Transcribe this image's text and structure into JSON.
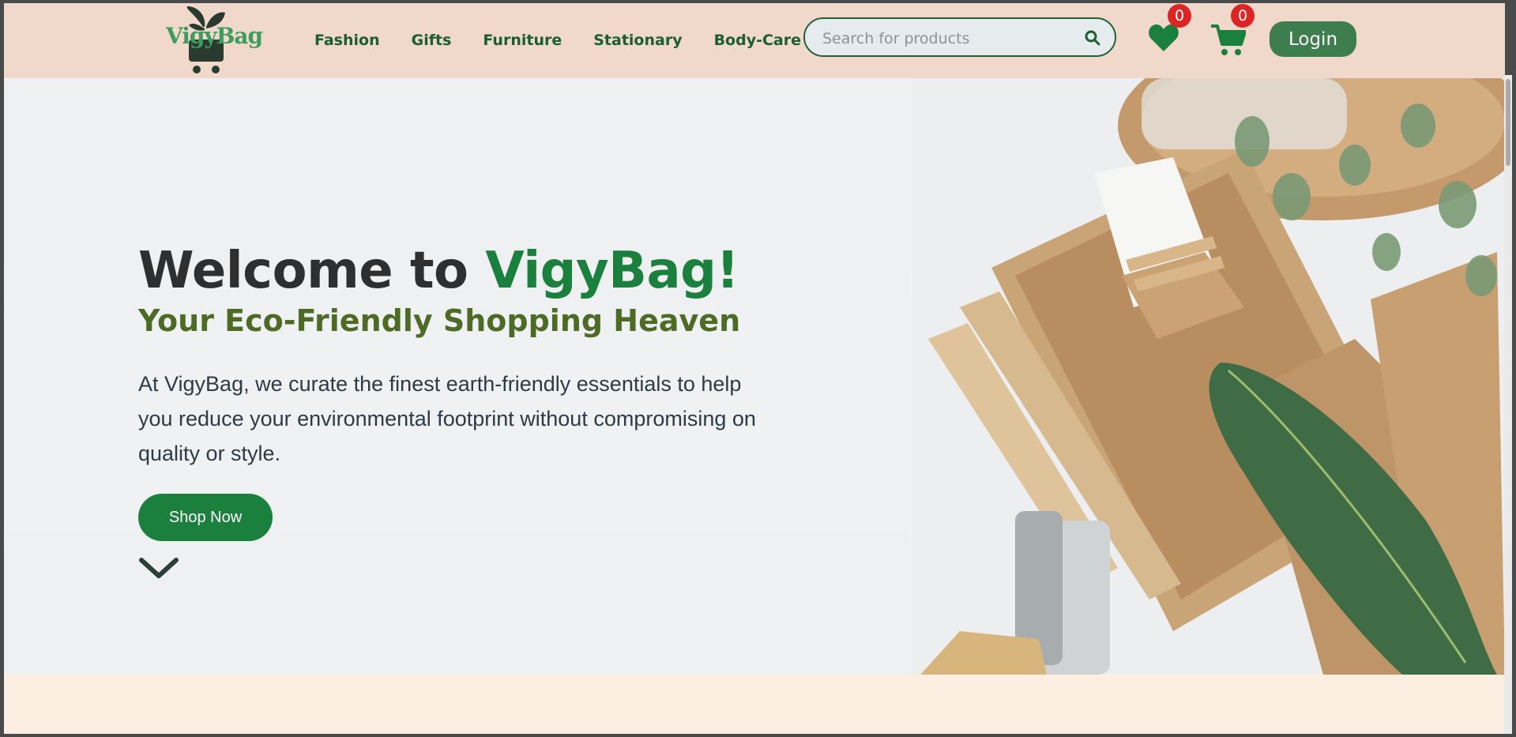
{
  "brand": {
    "logo_text": "VigyBag"
  },
  "nav": {
    "items": [
      {
        "label": "Fashion"
      },
      {
        "label": "Gifts"
      },
      {
        "label": "Furniture"
      },
      {
        "label": "Stationary"
      },
      {
        "label": "Body-Care"
      }
    ]
  },
  "search": {
    "placeholder": "Search for products",
    "value": ""
  },
  "wishlist": {
    "count": "0"
  },
  "cart": {
    "count": "0"
  },
  "header": {
    "login_label": "Login"
  },
  "hero": {
    "title_prefix": "Welcome to ",
    "title_brand": "VigyBag!",
    "subtitle": "Your Eco-Friendly Shopping Heaven",
    "description": "At VigyBag, we curate the finest earth-friendly essentials to help you reduce your environmental footprint without compromising on quality or style.",
    "cta_label": "Shop Now"
  },
  "colors": {
    "header_bg": "#f0d9cb",
    "brand_green": "#1b7f3e",
    "nav_text": "#1b5e31",
    "subtitle": "#4d6b25",
    "badge": "#dc2626",
    "login_bg": "#3d7d4e"
  },
  "icons": [
    "plant-cart-logo-icon",
    "search-icon",
    "heart-icon",
    "cart-icon",
    "chevron-down-icon"
  ]
}
